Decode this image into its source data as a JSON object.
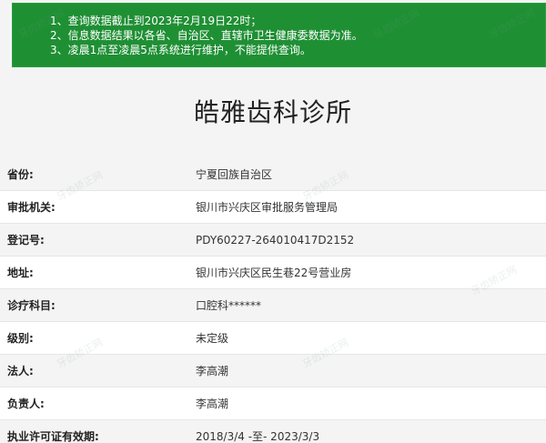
{
  "notice": {
    "lines": [
      "1、查询数据截止到2023年2月19日22时；",
      "2、信息数据结果以各省、自治区、直辖市卫生健康委数据为准。",
      "3、凌晨1点至凌晨5点系统进行维护，不能提供查询。"
    ]
  },
  "clinic": {
    "name": "皓雅齿科诊所"
  },
  "details": [
    {
      "label": "省份:",
      "value": "宁夏回族自治区"
    },
    {
      "label": "审批机关:",
      "value": "银川市兴庆区审批服务管理局"
    },
    {
      "label": "登记号:",
      "value": "PDY60227-264010417D2152"
    },
    {
      "label": "地址:",
      "value": "银川市兴庆区民生巷22号营业房"
    },
    {
      "label": "诊疗科目:",
      "value": "口腔科******"
    },
    {
      "label": "级别:",
      "value": "未定级"
    },
    {
      "label": "法人:",
      "value": "李高潮"
    },
    {
      "label": "负责人:",
      "value": "李高潮"
    },
    {
      "label": "执业许可证有效期:",
      "value": "2018/3/4 -至- 2023/3/3"
    }
  ],
  "watermark": {
    "text": "牙齿矫正网"
  },
  "colors": {
    "notice_bg": "#1f8f34",
    "title_text": "#222222"
  }
}
